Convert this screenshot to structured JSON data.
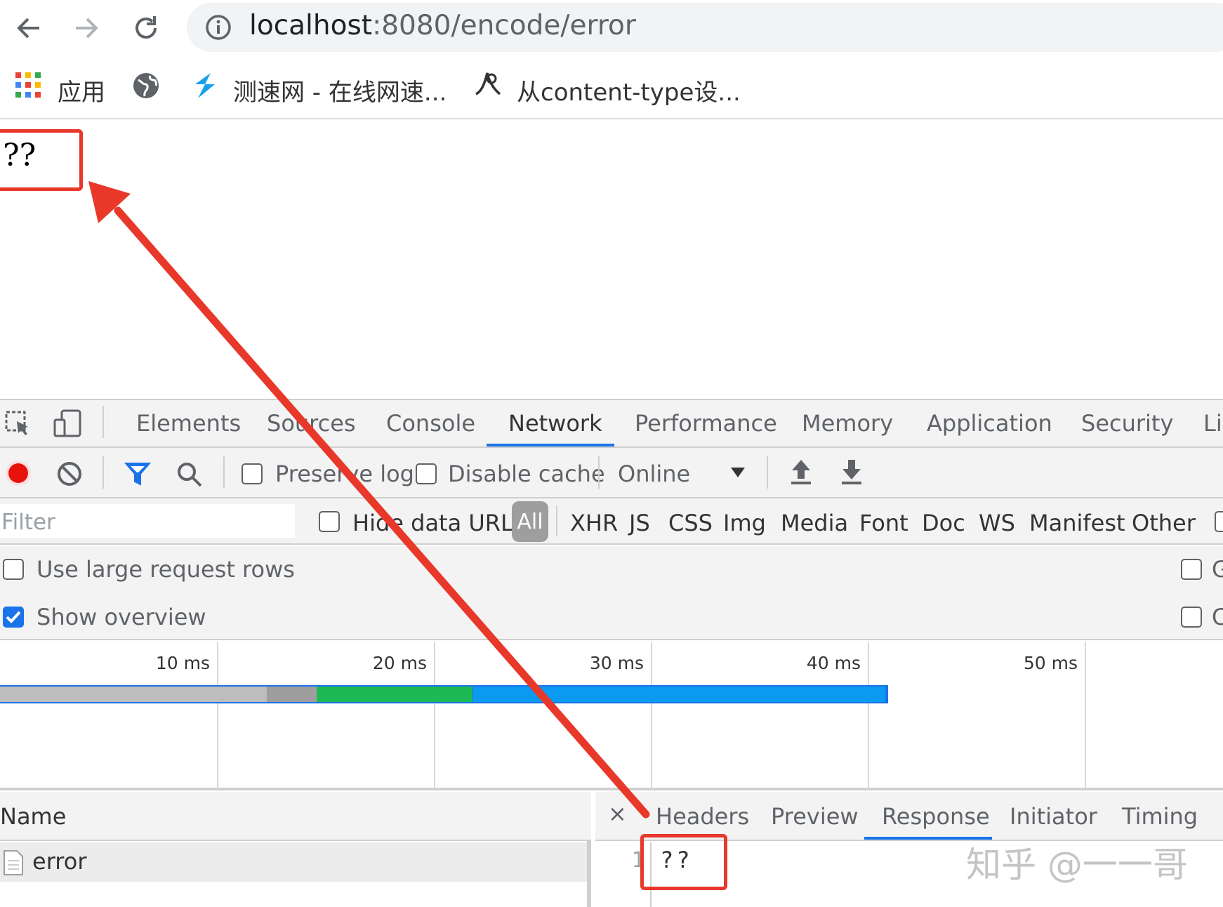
{
  "browser": {
    "url_host": "localhost",
    "url_rest": ":8080/encode/error",
    "bookmarks": [
      {
        "label": "应用",
        "icon": "apps-grid-icon"
      },
      {
        "label": "",
        "icon": "globe-icon"
      },
      {
        "label": "测速网 - 在线网速...",
        "icon": "speedtest-icon"
      },
      {
        "label": "从content-type设...",
        "icon": "bookmark-site-icon"
      }
    ]
  },
  "page": {
    "body_text": "??"
  },
  "devtools": {
    "tabs": [
      "Elements",
      "Sources",
      "Console",
      "Network",
      "Performance",
      "Memory",
      "Application",
      "Security",
      "Li"
    ],
    "active_tab": "Network",
    "toolbar": {
      "preserve_log": "Preserve log",
      "disable_cache": "Disable cache",
      "throttle": "Online"
    },
    "filter": {
      "placeholder": "Filter",
      "hide_data_urls": "Hide data URLs",
      "all": "All",
      "types": [
        "XHR",
        "JS",
        "CSS",
        "Img",
        "Media",
        "Font",
        "Doc",
        "WS",
        "Manifest",
        "Other"
      ]
    },
    "options": {
      "large_rows": "Use large request rows",
      "large_rows_checked": false,
      "show_overview": "Show overview",
      "show_overview_checked": true,
      "right_1": "G",
      "right_2": "C"
    },
    "timeline": {
      "ticks": [
        "10 ms",
        "20 ms",
        "30 ms",
        "40 ms",
        "50 ms"
      ],
      "bar_segments_ms": [
        {
          "phase": "queue",
          "start": 0,
          "end": 12.3,
          "color": "#bdbdbd"
        },
        {
          "phase": "stall",
          "start": 12.3,
          "end": 14.6,
          "color": "#9e9e9e"
        },
        {
          "phase": "waiting",
          "start": 14.6,
          "end": 21.8,
          "color": "#1db954"
        },
        {
          "phase": "download",
          "start": 21.8,
          "end": 40.8,
          "color": "#0a9af2"
        }
      ]
    },
    "requests": {
      "header": "Name",
      "rows": [
        {
          "name": "error"
        }
      ]
    },
    "detail": {
      "close": "×",
      "tabs": [
        "Headers",
        "Preview",
        "Response",
        "Initiator",
        "Timing"
      ],
      "active_tab": "Response",
      "line_number": "1",
      "response_text": "??"
    }
  },
  "watermark": "知乎 @一一哥",
  "colors": {
    "annotation_red": "#e8382a",
    "accent_blue": "#1a73e8",
    "record_red": "#d93025"
  }
}
